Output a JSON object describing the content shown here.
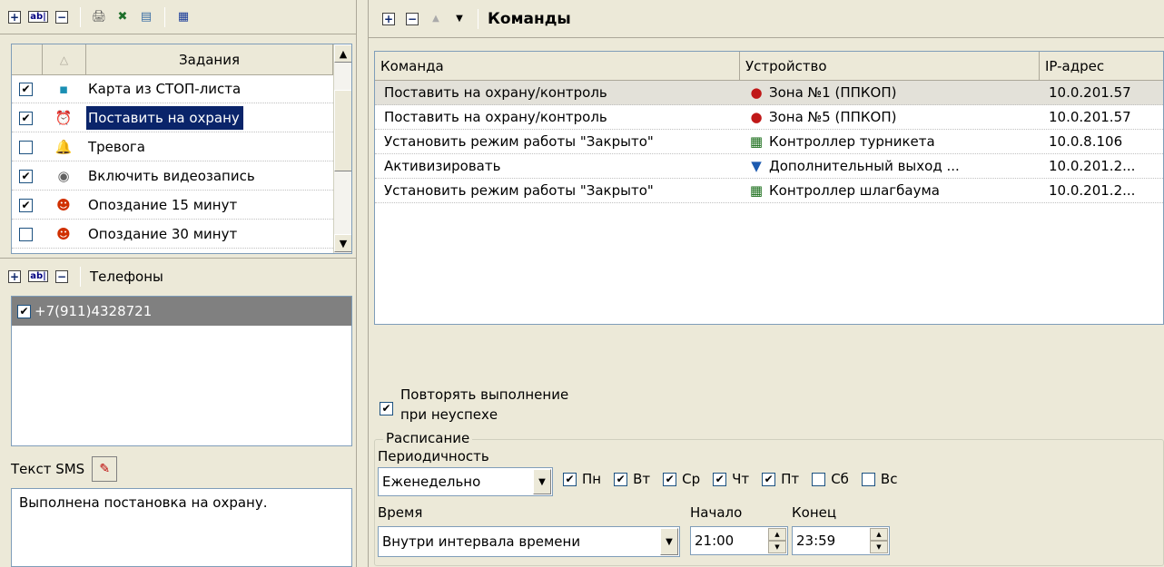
{
  "tasks": {
    "header": "Задания",
    "sort_glyph": "△",
    "items": [
      {
        "label": "Карта из СТОП-листа",
        "checked": true,
        "icon": "map-pin-icon",
        "selected": false
      },
      {
        "label": "Поставить на охрану",
        "checked": true,
        "icon": "alarm-clock-icon",
        "selected": true
      },
      {
        "label": "Тревога",
        "checked": false,
        "icon": "alarm-bell-icon",
        "selected": false
      },
      {
        "label": "Включить видеозапись",
        "checked": true,
        "icon": "video-record-icon",
        "selected": false
      },
      {
        "label": "Опоздание 15 минут",
        "checked": true,
        "icon": "late-person-icon",
        "selected": false
      },
      {
        "label": "Опоздание 30 минут",
        "checked": false,
        "icon": "late-person-icon",
        "selected": false
      }
    ]
  },
  "phones": {
    "title": "Телефоны",
    "items": [
      {
        "number": "+7(911)4328721",
        "checked": true
      }
    ]
  },
  "sms": {
    "label": "Текст SMS",
    "text": "Выполнена постановка на охрану."
  },
  "commands": {
    "title": "Команды",
    "columns": [
      "Команда",
      "Устройство",
      "IP-адрес"
    ],
    "rows": [
      {
        "command": "Поставить на охрану/контроль",
        "device": "Зона №1 (ППКОП)",
        "ip": "10.0.201.57",
        "icon": "zone-sensor-icon"
      },
      {
        "command": "Поставить на охрану/контроль",
        "device": "Зона №5 (ППКОП)",
        "ip": "10.0.201.57",
        "icon": "zone-sensor-icon"
      },
      {
        "command": "Установить режим работы \"Закрыто\"",
        "device": "Контроллер турникета",
        "ip": "10.0.8.106",
        "icon": "turnstile-controller-icon"
      },
      {
        "command": "Активизировать",
        "device": "Дополнительный выход ...",
        "ip": "10.0.201.2...",
        "icon": "output-triangle-icon"
      },
      {
        "command": "Установить режим работы \"Закрыто\"",
        "device": "Контроллер шлагбаума",
        "ip": "10.0.201.2...",
        "icon": "barrier-controller-icon"
      }
    ]
  },
  "retry": {
    "line1": "Повторять выполнение",
    "line2": "при неуспехе",
    "checked": true
  },
  "schedule": {
    "legend": "Расписание",
    "periodicity_label": "Периодичность",
    "periodicity_value": "Еженедельно",
    "days": [
      {
        "label": "Пн",
        "checked": true
      },
      {
        "label": "Вт",
        "checked": true
      },
      {
        "label": "Ср",
        "checked": true
      },
      {
        "label": "Чт",
        "checked": true
      },
      {
        "label": "Пт",
        "checked": true
      },
      {
        "label": "Сб",
        "checked": false
      },
      {
        "label": "Вс",
        "checked": false
      }
    ],
    "time_label": "Время",
    "time_value": "Внутри интервала времени",
    "start_label": "Начало",
    "start_value": "21:00",
    "end_label": "Конец",
    "end_value": "23:59"
  },
  "colors": {
    "selection": "#0a246a",
    "window": "#ECE9D8",
    "phone_selected": "#808080"
  }
}
